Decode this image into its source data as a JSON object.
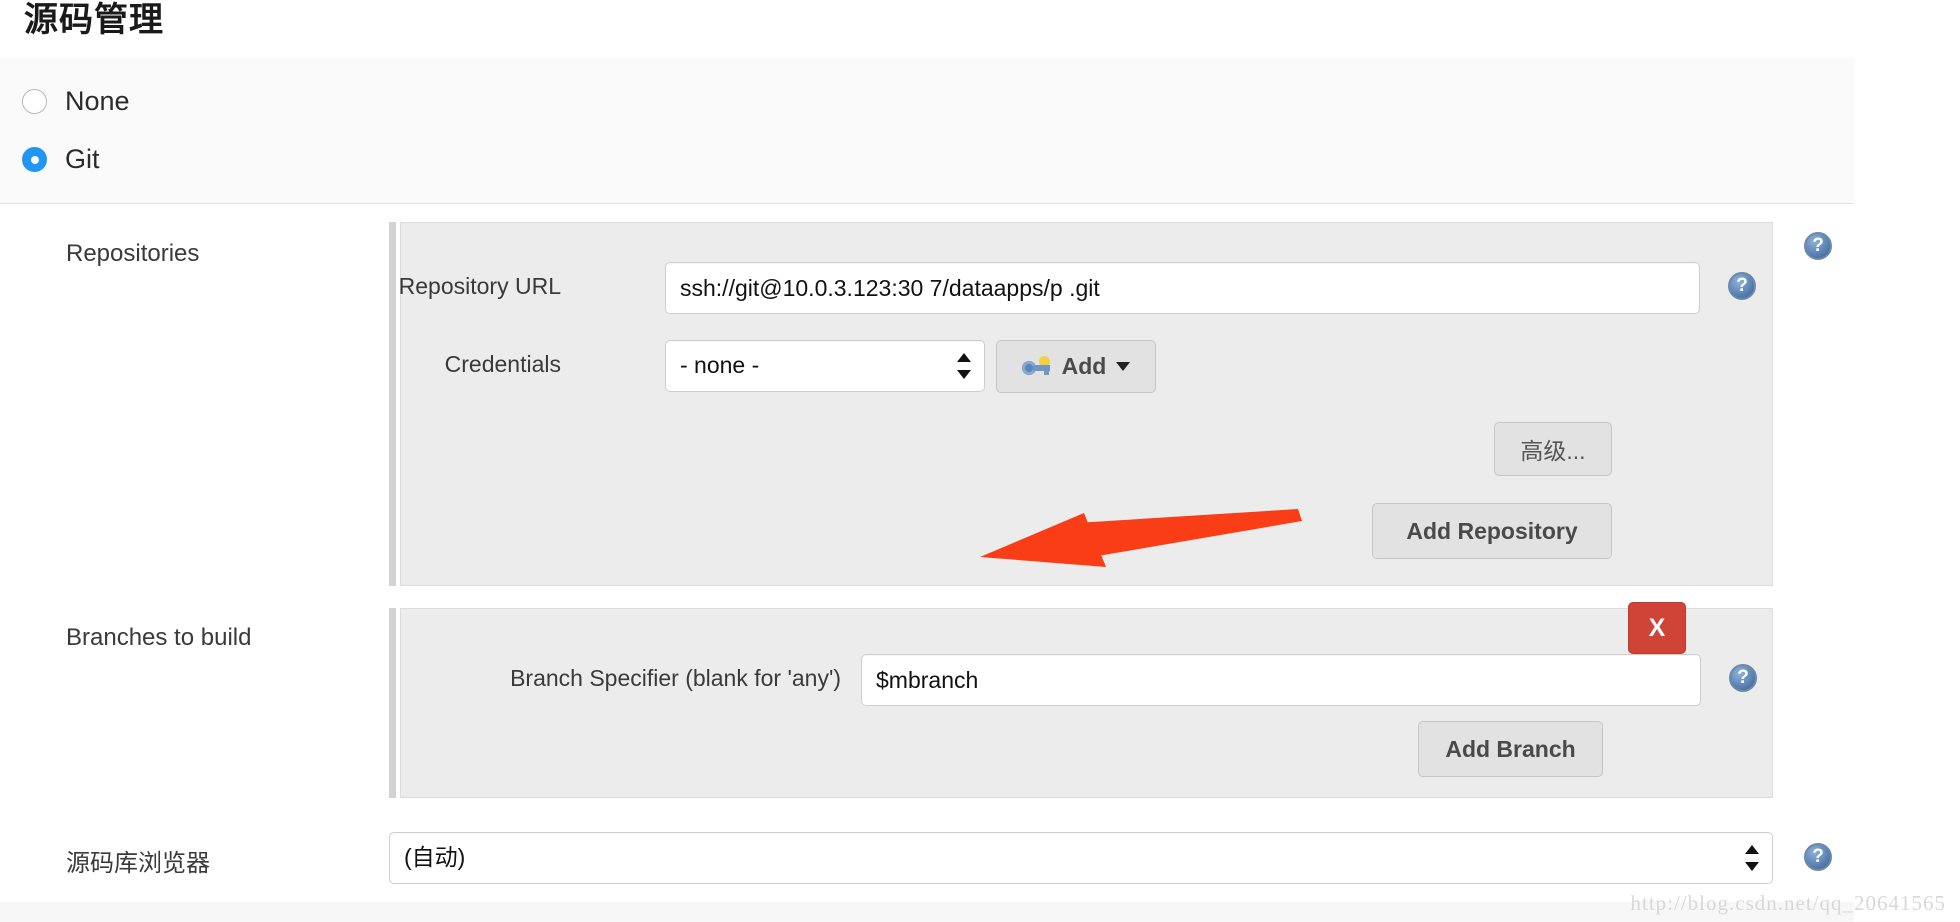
{
  "page": {
    "title": "源码管理",
    "watermark": "http://blog.csdn.net/qq_20641565"
  },
  "scm_choice": {
    "options": [
      {
        "label": "None",
        "selected": false
      },
      {
        "label": "Git",
        "selected": true
      }
    ]
  },
  "repositories": {
    "section_label": "Repositories",
    "repository_url": {
      "label": "Repository URL",
      "value": "ssh://git@10.0.3.123:30  7/dataapps/p           .git"
    },
    "credentials": {
      "label": "Credentials",
      "value": "- none -",
      "add_button": "Add"
    },
    "advanced_button": "高级...",
    "add_repository_button": "Add Repository"
  },
  "branches": {
    "section_label": "Branches to build",
    "remove_button": "X",
    "branch_specifier": {
      "label": "Branch Specifier (blank for 'any')",
      "value": "$mbranch"
    },
    "add_branch_button": "Add Branch"
  },
  "repository_browser": {
    "label": "源码库浏览器",
    "value": "(自动)"
  },
  "icons": {
    "help": "?"
  },
  "colors": {
    "accent_blue": "#2196f3",
    "danger_red": "#cf4436",
    "annotation_orange": "#f93d16",
    "panel_gray": "#ececec"
  }
}
